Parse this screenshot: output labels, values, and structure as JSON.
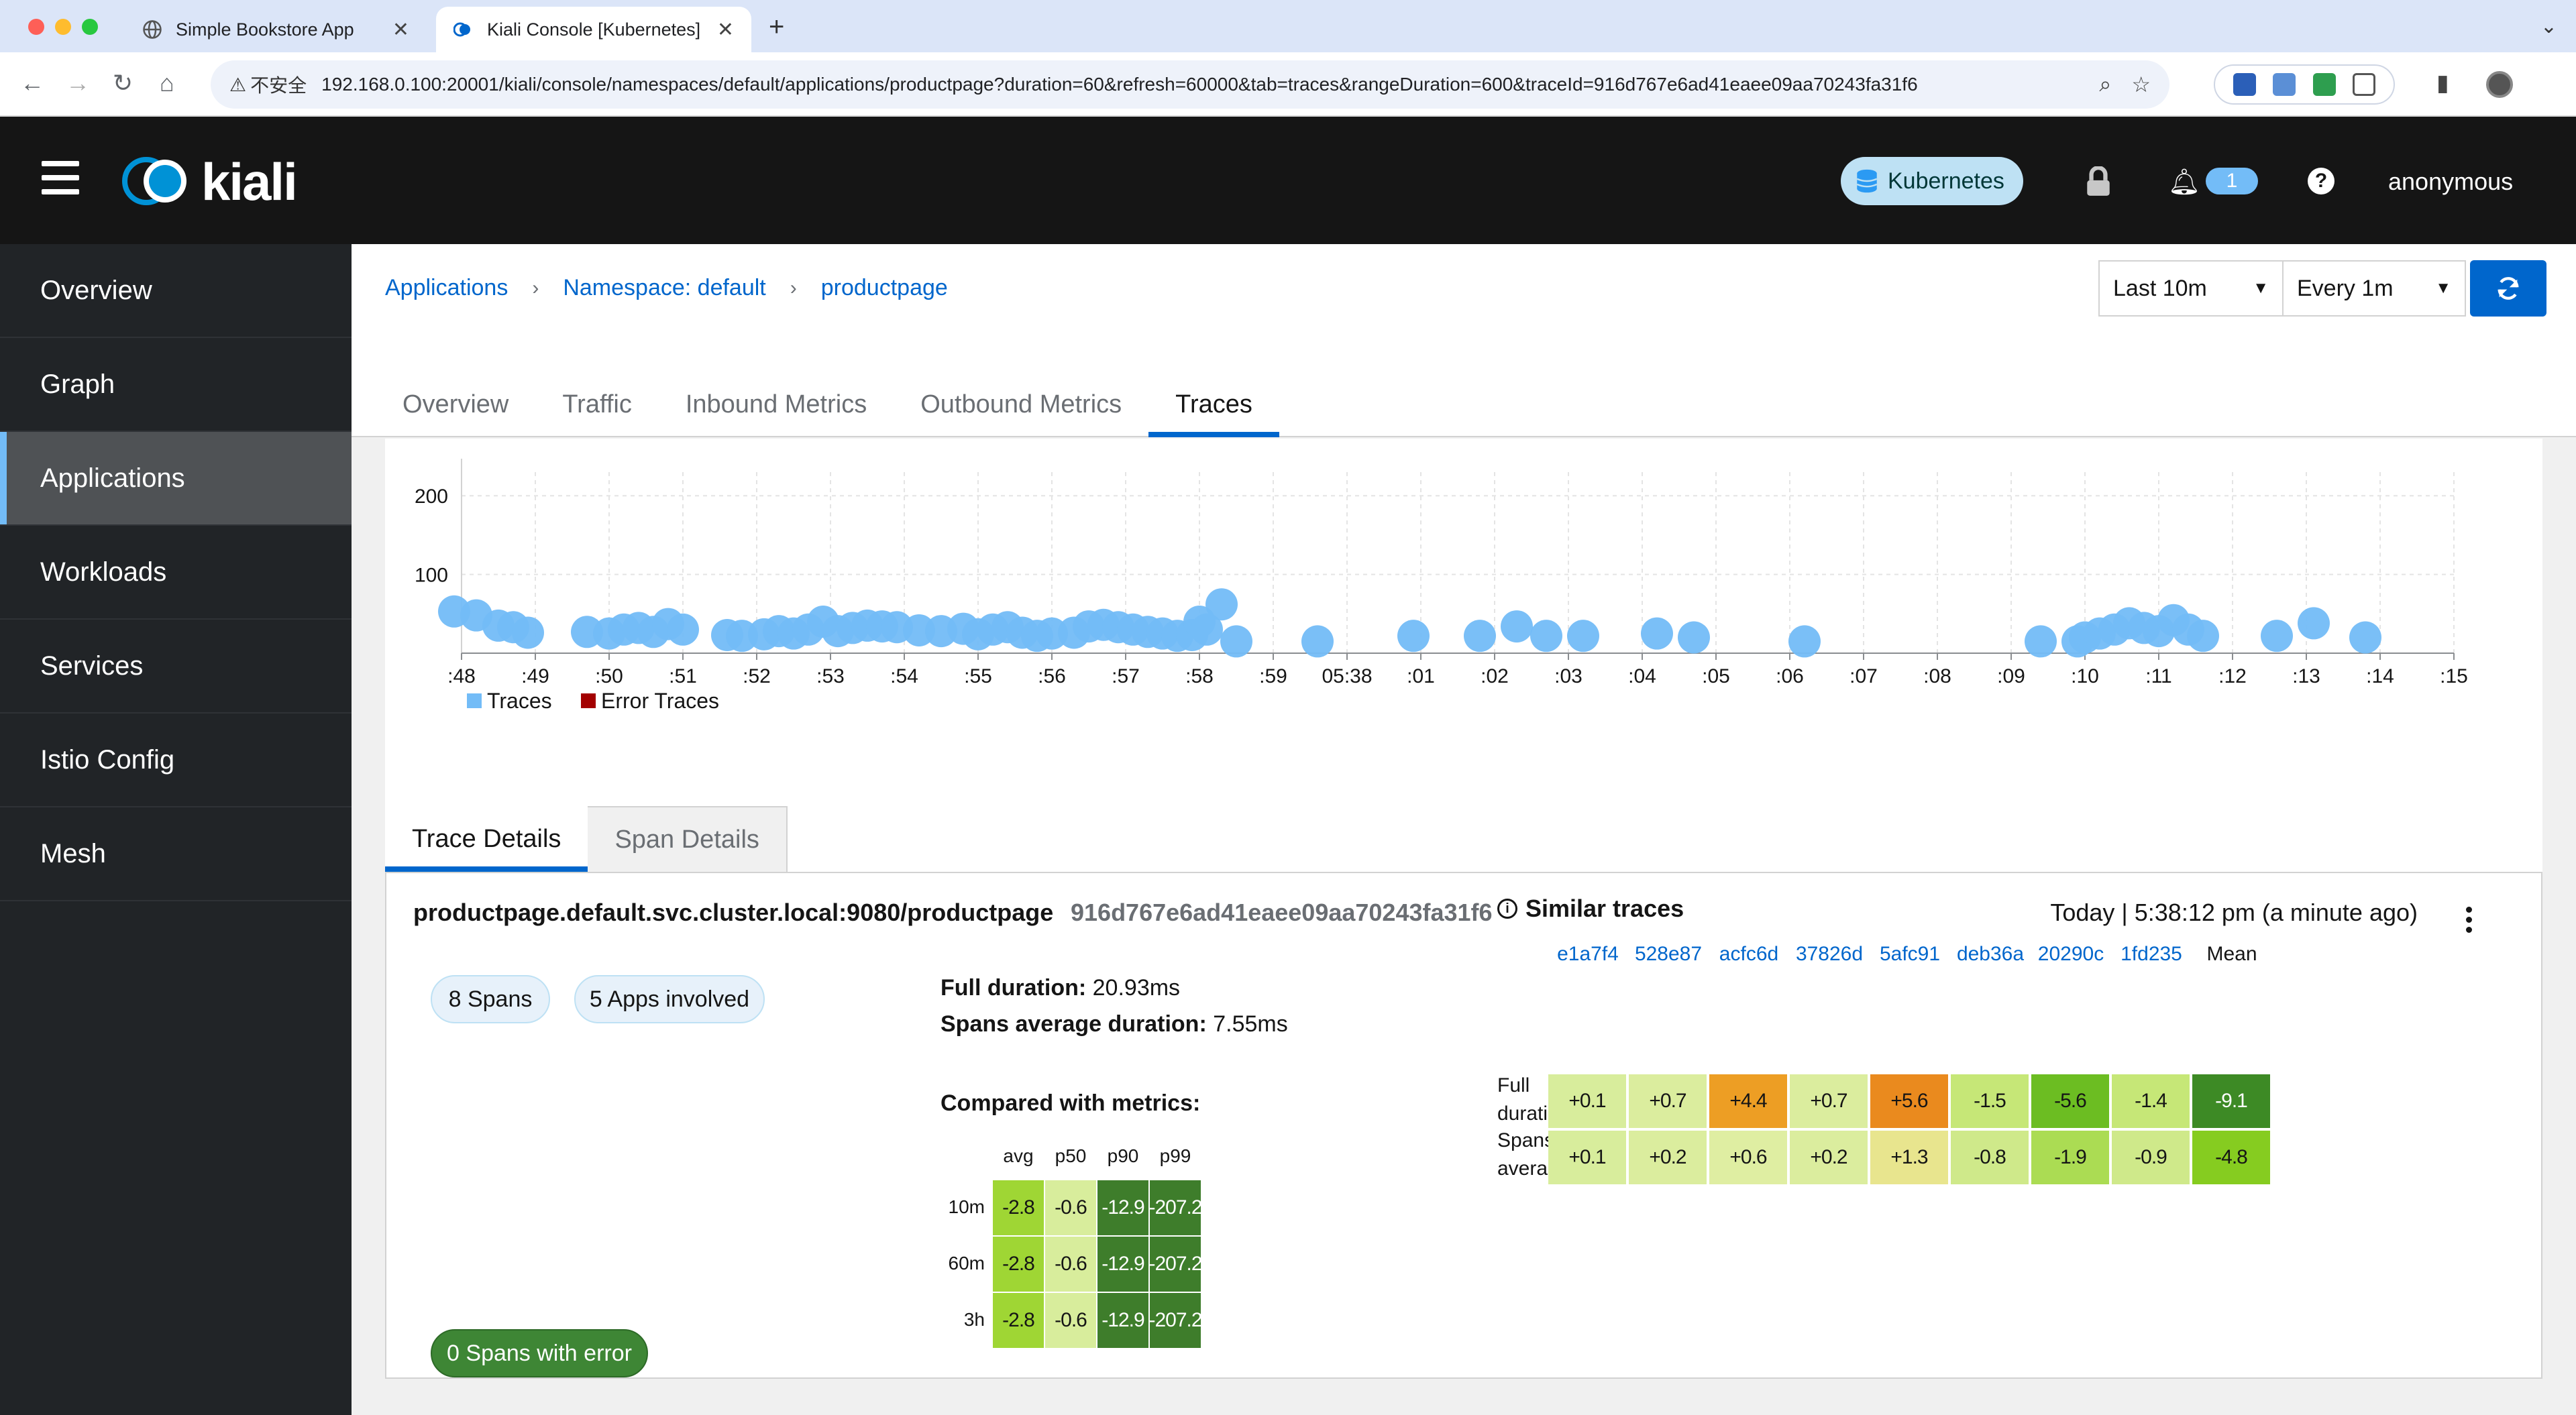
{
  "browser": {
    "tabs": [
      {
        "title": "Simple Bookstore App",
        "active": false
      },
      {
        "title": "Kiali Console [Kubernetes]",
        "active": true
      }
    ],
    "insecure_label": "不安全",
    "url": "192.168.0.100:20001/kiali/console/namespaces/default/applications/productpage?duration=60&refresh=60000&tab=traces&rangeDuration=600&traceId=916d767e6ad41eaee09aa70243fa31f6"
  },
  "masthead": {
    "logo_text": "kiali",
    "cluster": "Kubernetes",
    "notification_count": "1",
    "help": "?",
    "user": "anonymous"
  },
  "sidebar": {
    "items": [
      {
        "label": "Overview",
        "current": false
      },
      {
        "label": "Graph",
        "current": false
      },
      {
        "label": "Applications",
        "current": true
      },
      {
        "label": "Workloads",
        "current": false
      },
      {
        "label": "Services",
        "current": false
      },
      {
        "label": "Istio Config",
        "current": false
      },
      {
        "label": "Mesh",
        "current": false
      }
    ]
  },
  "breadcrumb": [
    "Applications",
    "Namespace: default",
    "productpage"
  ],
  "time_controls": {
    "range": "Last 10m",
    "refresh": "Every 1m"
  },
  "tabs": [
    {
      "label": "Overview",
      "current": false
    },
    {
      "label": "Traffic",
      "current": false
    },
    {
      "label": "Inbound Metrics",
      "current": false
    },
    {
      "label": "Outbound Metrics",
      "current": false
    },
    {
      "label": "Traces",
      "current": true
    }
  ],
  "colors": {
    "trace": "#73bcf7",
    "error": "#a30000",
    "accent": "#0066cc"
  },
  "chart_data": {
    "type": "scatter",
    "y_ticks": [
      100,
      200
    ],
    "ylim": [
      0,
      230
    ],
    "x_tick_labels": [
      ":48",
      ":49",
      ":50",
      ":51",
      ":52",
      ":53",
      ":54",
      ":55",
      ":56",
      ":57",
      ":58",
      ":59",
      "05:38",
      ":01",
      ":02",
      ":03",
      ":04",
      ":05",
      ":06",
      ":07",
      ":08",
      ":09",
      ":10",
      ":11",
      ":12",
      ":13",
      ":14",
      ":15"
    ],
    "x_range_minutes": [
      0,
      27
    ],
    "grid": true,
    "legend_position": "bottom-left",
    "legend": [
      "Traces",
      "Error Traces"
    ],
    "series": [
      {
        "name": "Traces",
        "points": [
          [
            -0.1,
            53
          ],
          [
            0.2,
            48
          ],
          [
            0.5,
            35
          ],
          [
            0.7,
            33
          ],
          [
            0.9,
            26
          ],
          [
            1.7,
            27
          ],
          [
            2.0,
            25
          ],
          [
            2.2,
            30
          ],
          [
            2.4,
            32
          ],
          [
            2.6,
            27
          ],
          [
            2.8,
            37
          ],
          [
            3.0,
            30
          ],
          [
            3.6,
            23
          ],
          [
            3.8,
            22
          ],
          [
            4.1,
            24
          ],
          [
            4.3,
            28
          ],
          [
            4.5,
            25
          ],
          [
            4.7,
            30
          ],
          [
            4.9,
            40
          ],
          [
            5.1,
            28
          ],
          [
            5.3,
            32
          ],
          [
            5.5,
            35
          ],
          [
            5.7,
            34
          ],
          [
            5.9,
            33
          ],
          [
            6.2,
            29
          ],
          [
            6.5,
            28
          ],
          [
            6.8,
            31
          ],
          [
            7.0,
            24
          ],
          [
            7.2,
            30
          ],
          [
            7.4,
            33
          ],
          [
            7.6,
            26
          ],
          [
            7.8,
            22
          ],
          [
            8.0,
            25
          ],
          [
            8.3,
            26
          ],
          [
            8.5,
            34
          ],
          [
            8.7,
            36
          ],
          [
            8.9,
            33
          ],
          [
            9.1,
            30
          ],
          [
            9.3,
            27
          ],
          [
            9.5,
            25
          ],
          [
            9.7,
            22
          ],
          [
            9.9,
            23
          ],
          [
            10.0,
            40
          ],
          [
            10.1,
            30
          ],
          [
            10.3,
            62
          ],
          [
            10.5,
            15
          ],
          [
            11.6,
            15
          ],
          [
            12.9,
            22
          ],
          [
            13.8,
            22
          ],
          [
            14.3,
            34
          ],
          [
            14.7,
            22
          ],
          [
            15.2,
            22
          ],
          [
            16.2,
            25
          ],
          [
            16.7,
            20
          ],
          [
            18.2,
            15
          ],
          [
            21.4,
            15
          ],
          [
            21.9,
            15
          ],
          [
            22.0,
            20
          ],
          [
            22.2,
            25
          ],
          [
            22.4,
            30
          ],
          [
            22.6,
            38
          ],
          [
            22.8,
            32
          ],
          [
            23.0,
            28
          ],
          [
            23.2,
            42
          ],
          [
            23.4,
            30
          ],
          [
            23.6,
            22
          ],
          [
            24.6,
            22
          ],
          [
            25.1,
            38
          ],
          [
            25.8,
            20
          ]
        ]
      },
      {
        "name": "Error Traces",
        "points": []
      }
    ]
  },
  "detail_tabs": [
    {
      "label": "Trace Details",
      "current": true
    },
    {
      "label": "Span Details",
      "current": false
    }
  ],
  "trace": {
    "service": "productpage.default.svc.cluster.local:9080/productpage",
    "id": "916d767e6ad41eaee09aa70243fa31f6",
    "time": "Today | 5:38:12 pm (a minute ago)",
    "spans": "8 Spans",
    "apps": "5 Apps involved",
    "errors": "0 Spans with error",
    "full_duration_label": "Full duration:",
    "full_duration_value": "20.93ms",
    "avg_duration_label": "Spans average duration:",
    "avg_duration_value": "7.55ms",
    "compared_title": "Compared with metrics:",
    "metrics": {
      "columns": [
        "avg",
        "p50",
        "p90",
        "p99"
      ],
      "rows": [
        {
          "label": "10m",
          "values": [
            "-2.8",
            "-0.6",
            "-12.9",
            "-207.2"
          ]
        },
        {
          "label": "60m",
          "values": [
            "-2.8",
            "-0.6",
            "-12.9",
            "-207.2"
          ]
        },
        {
          "label": "3h",
          "values": [
            "-2.8",
            "-0.6",
            "-12.9",
            "-207.2"
          ]
        }
      ],
      "colors": [
        "#9fd634",
        "#d8ed9c",
        "#3e7d2b",
        "#3e7d2b"
      ]
    },
    "similar": {
      "title": "Similar traces",
      "columns": [
        "e1a7f4",
        "528e87",
        "acfc6d",
        "37826d",
        "5afc91",
        "deb36a",
        "20290c",
        "1fd235"
      ],
      "mean_label": "Mean",
      "row_labels": [
        "Full duration",
        "Spans average"
      ],
      "full_duration": [
        "+0.1",
        "+0.7",
        "+4.4",
        "+0.7",
        "+5.6",
        "-1.5",
        "-5.6",
        "-1.4",
        "-9.1"
      ],
      "spans_average": [
        "+0.1",
        "+0.2",
        "+0.6",
        "+0.2",
        "+1.3",
        "-0.8",
        "-1.9",
        "-0.9",
        "-4.8"
      ],
      "full_colors": [
        "#d8ed9c",
        "#dbed9e",
        "#ed9e24",
        "#dbed9e",
        "#ea8a1e",
        "#c6e777",
        "#6cbd22",
        "#c6e777",
        "#3d8a25"
      ],
      "avg_colors": [
        "#d8ed9c",
        "#dbed9e",
        "#dfeea2",
        "#dbed9e",
        "#e8e58e",
        "#cfe98a",
        "#abdc53",
        "#cfe98a",
        "#86cc20"
      ]
    }
  }
}
